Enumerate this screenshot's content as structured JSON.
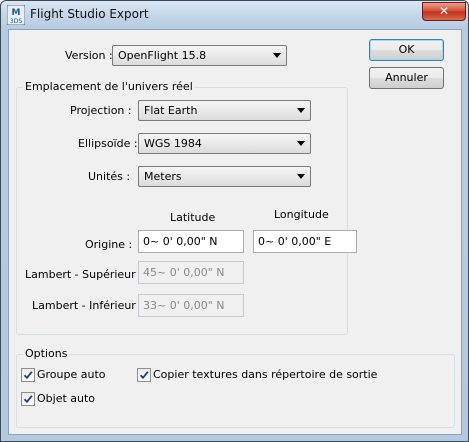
{
  "window": {
    "title": "Flight Studio Export",
    "close_glyph": "✕",
    "app_icon": "3ds-max-icon"
  },
  "version": {
    "label": "Version :",
    "value": "OpenFlight 15.8"
  },
  "buttons": {
    "ok": "OK",
    "cancel": "Annuler"
  },
  "location_group": {
    "title": "Emplacement de l'univers réel",
    "projection": {
      "label": "Projection :",
      "value": "Flat Earth"
    },
    "ellipsoid": {
      "label": "Ellipsoïde :",
      "value": "WGS 1984"
    },
    "units": {
      "label": "Unités :",
      "value": "Meters"
    },
    "col_latitude": "Latitude",
    "col_longitude": "Longitude",
    "origin": {
      "label": "Origine :",
      "latitude": "0~ 0' 0,00\" N",
      "longitude": "0~ 0' 0,00\" E"
    },
    "lambert_upper": {
      "label": "Lambert - Supérieur :",
      "value": "45~ 0' 0,00\" N"
    },
    "lambert_lower": {
      "label": "Lambert - Inférieur :",
      "value": "33~ 0' 0,00\" N"
    }
  },
  "options_group": {
    "title": "Options",
    "auto_group": {
      "label": "Groupe auto",
      "checked": true
    },
    "auto_object": {
      "label": "Objet auto",
      "checked": true
    },
    "copy_textures": {
      "label": "Copier textures dans répertoire de sortie",
      "checked": true
    }
  },
  "colors": {
    "title_gradient_top": "#dbe8f4",
    "close_red": "#c0301a",
    "default_button_border": "#3c7fb1"
  }
}
